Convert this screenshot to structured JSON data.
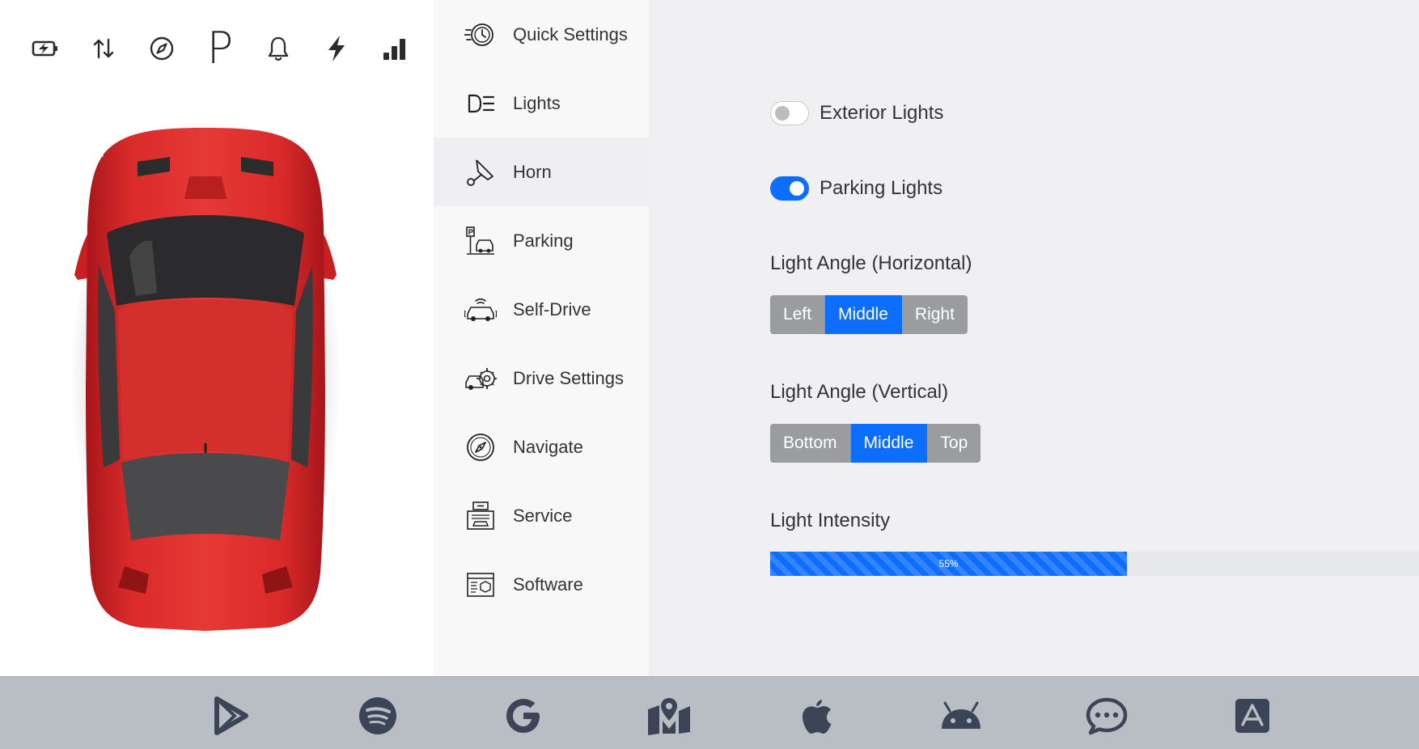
{
  "status_bar": {
    "icons": [
      "battery-charging-icon",
      "data-transfer-icon",
      "compass-icon",
      "parking-icon",
      "bell-icon",
      "lightning-icon",
      "signal-bars-icon"
    ],
    "parking_glyph": "P"
  },
  "menu": {
    "items": [
      {
        "label": "Quick Settings",
        "icon": "speedometer-clock-icon"
      },
      {
        "label": "Lights",
        "icon": "headlight-icon"
      },
      {
        "label": "Horn",
        "icon": "horn-icon"
      },
      {
        "label": "Parking",
        "icon": "parking-sign-car-icon"
      },
      {
        "label": "Self-Drive",
        "icon": "self-drive-car-icon"
      },
      {
        "label": "Drive Settings",
        "icon": "car-gear-icon"
      },
      {
        "label": "Navigate",
        "icon": "compass-rose-icon"
      },
      {
        "label": "Service",
        "icon": "garage-icon"
      },
      {
        "label": "Software",
        "icon": "software-window-icon"
      }
    ],
    "active": "Horn"
  },
  "settings": {
    "exterior_lights": {
      "label": "Exterior Lights",
      "on": false
    },
    "parking_lights": {
      "label": "Parking Lights",
      "on": true
    },
    "horizontal": {
      "label": "Light Angle (Horizontal)",
      "options": [
        "Left",
        "Middle",
        "Right"
      ],
      "selected": "Middle"
    },
    "vertical": {
      "label": "Light Angle (Vertical)",
      "options": [
        "Bottom",
        "Middle",
        "Top"
      ],
      "selected": "Middle"
    },
    "intensity": {
      "label": "Light Intensity",
      "value": 55,
      "text": "55%"
    }
  },
  "dock": {
    "apps": [
      "play-store-icon",
      "spotify-icon",
      "google-icon",
      "map-pin-icon",
      "apple-icon",
      "android-icon",
      "chat-bubble-icon",
      "app-store-icon"
    ]
  },
  "colors": {
    "accent": "#0d6efd",
    "car_body": "#d92a2a",
    "dock_bg": "#b9bec5",
    "content_bg": "#f0eff2",
    "menu_bg": "#f8f8f9"
  }
}
